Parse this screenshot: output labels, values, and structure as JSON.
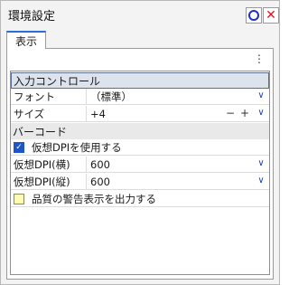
{
  "window": {
    "title": "環境設定"
  },
  "titlebar_buttons": {
    "circle": "circle-icon",
    "close": "close-icon"
  },
  "tabs": [
    {
      "label": "表示"
    }
  ],
  "more_icon": "⋮",
  "sections": {
    "input_controls": {
      "label": "入力コントロール"
    },
    "barcode": {
      "label": "バーコード"
    }
  },
  "rows": {
    "font": {
      "label": "フォント",
      "value": "（標準）"
    },
    "size": {
      "label": "サイズ",
      "value": "+4",
      "minus": "−",
      "plus": "+"
    },
    "use_virtual_dpi": {
      "label": "仮想DPIを使用する",
      "checked": true
    },
    "dpi_h": {
      "label": "仮想DPI(横)",
      "value": "600"
    },
    "dpi_v": {
      "label": "仮想DPI(縦)",
      "value": "600"
    },
    "quality_warning": {
      "label": "品質の警告表示を出力する",
      "checked": false
    }
  },
  "colors": {
    "accent": "#1c2fd1",
    "close": "#e0131a",
    "checkbox_checked": "#1f56c7",
    "checkbox_unchecked": "#fffbb4",
    "tab_highlight": "#2e6bd6"
  }
}
